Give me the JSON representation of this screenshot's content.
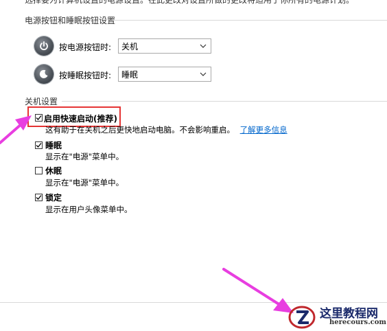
{
  "top_cut_text": "选择要为计算机设置的电源设置。在此更改对设置所做的更改将适用于你所有的电源计划。",
  "power_buttons_section": {
    "title": "电源按钮和睡眠按钮设置",
    "rows": [
      {
        "label": "按电源按钮时:",
        "value": "关机",
        "icon": "power-icon"
      },
      {
        "label": "按睡眠按钮时:",
        "value": "睡眠",
        "icon": "sleep-icon"
      }
    ]
  },
  "shutdown_section": {
    "title": "关机设置",
    "options": [
      {
        "label": "启用快速启动(推荐)",
        "checked": true,
        "desc": "这有助于在关机之后更快地启动电脑。不会影响重启。",
        "link": "了解更多信息"
      },
      {
        "label": "睡眠",
        "checked": true,
        "desc": "显示在\"电源\"菜单中。"
      },
      {
        "label": "休眠",
        "checked": false,
        "desc": "显示在\"电源\"菜单中。"
      },
      {
        "label": "锁定",
        "checked": true,
        "desc": "显示在用户头像菜单中。"
      }
    ]
  },
  "watermark": {
    "name": "这里教程网",
    "url": "herecours.com"
  },
  "colors": {
    "highlight_box": "#e53333",
    "arrow": "#e83ee0",
    "link": "#0066cc"
  }
}
